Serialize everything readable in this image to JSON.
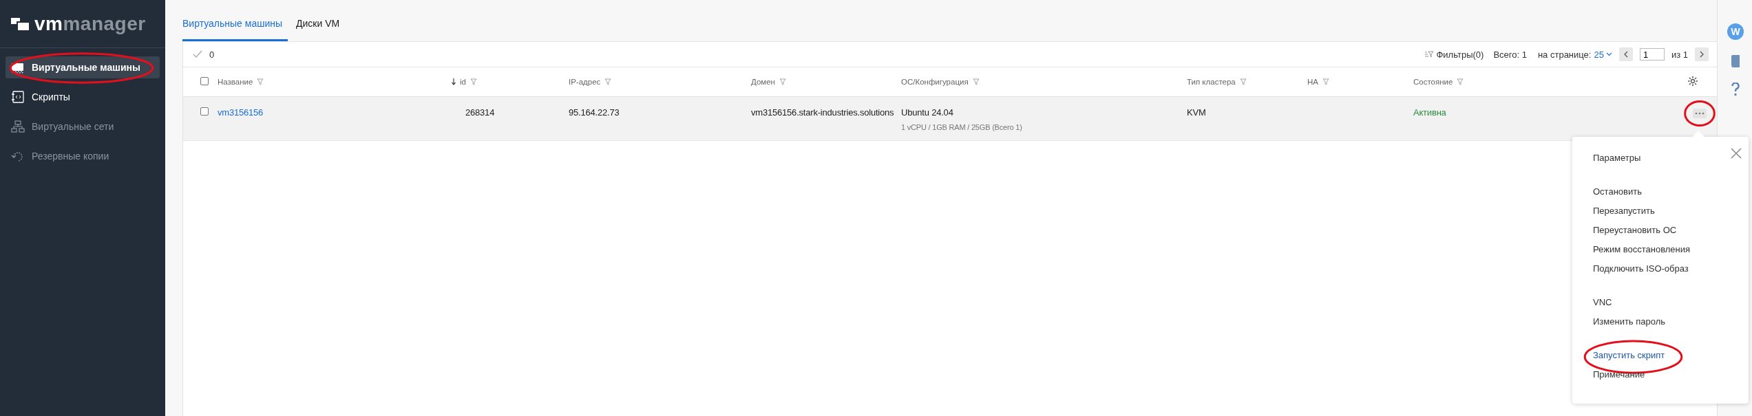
{
  "logo": {
    "prefix": "vm",
    "name": "manager"
  },
  "sidebar": {
    "items": [
      {
        "label": "Виртуальные машины",
        "selected": true,
        "disabled": false,
        "circled": true
      },
      {
        "label": "Скрипты",
        "selected": false,
        "disabled": false,
        "circled": false
      },
      {
        "label": "Виртуальные сети",
        "selected": false,
        "disabled": true,
        "circled": false
      },
      {
        "label": "Резервные копии",
        "selected": false,
        "disabled": true,
        "circled": false
      }
    ]
  },
  "tabs": [
    {
      "label": "Виртуальные машины",
      "selected": true
    },
    {
      "label": "Диски VM",
      "selected": false
    }
  ],
  "toolbar": {
    "selected_count": "0",
    "filters": "Фильтры(0)",
    "total": "Всего: 1",
    "per_page_label": "на странице:",
    "per_page": "25",
    "page": "1",
    "of_pages": "из 1"
  },
  "table": {
    "select_all": {
      "checked": false
    },
    "columns": [
      {
        "label": "Название",
        "sorted": false
      },
      {
        "label": "id",
        "sorted": true
      },
      {
        "label": "IP-адрес",
        "sorted": false
      },
      {
        "label": "Домен",
        "sorted": false
      },
      {
        "label": "ОС/Конфигурация",
        "sorted": false
      },
      {
        "label": "Тип кластера",
        "sorted": false
      },
      {
        "label": "HA",
        "sorted": false
      },
      {
        "label": "Состояние",
        "sorted": false
      }
    ],
    "rows": [
      {
        "checked": false,
        "name": "vm3156156",
        "id": "268314",
        "ip": "95.164.22.73",
        "domain": "vm3156156.stark-industries.solutions",
        "os": "Ubuntu 24.04",
        "config": "1 vCPU / 1GB RAM / 25GB (Всего 1)",
        "cluster": "KVM",
        "status": "Активна",
        "actions_circled": true
      }
    ]
  },
  "menu": {
    "groups": [
      [
        {
          "label": "Параметры",
          "selected": false,
          "circled": false
        }
      ],
      [
        {
          "label": "Остановить",
          "selected": false,
          "circled": false
        },
        {
          "label": "Перезапустить",
          "selected": false,
          "circled": false
        },
        {
          "label": "Переустановить ОС",
          "selected": false,
          "circled": false
        },
        {
          "label": "Режим восстановления",
          "selected": false,
          "circled": false
        },
        {
          "label": "Подключить ISO-образ",
          "selected": false,
          "circled": false
        }
      ],
      [
        {
          "label": "VNC",
          "selected": false,
          "circled": false
        },
        {
          "label": "Изменить пароль",
          "selected": false,
          "circled": false
        }
      ],
      [
        {
          "label": "Запустить скрипт",
          "selected": true,
          "circled": true
        },
        {
          "label": "Примечание",
          "selected": false,
          "circled": false
        }
      ]
    ]
  },
  "user": {
    "initial": "W"
  }
}
